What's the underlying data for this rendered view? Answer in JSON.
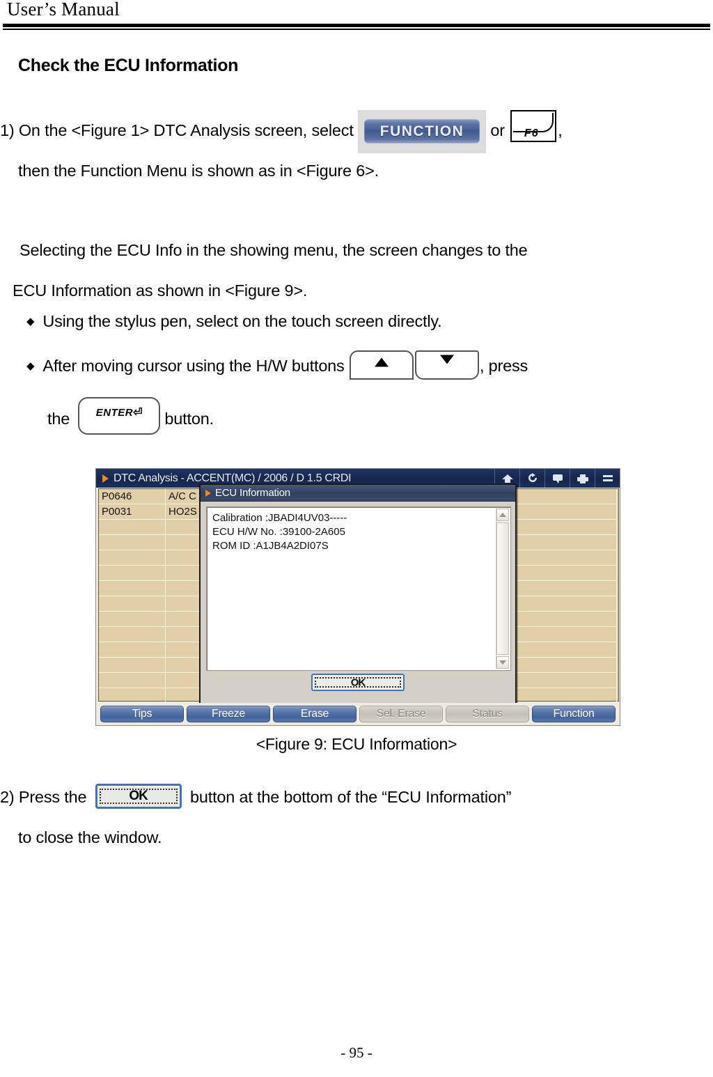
{
  "header": {
    "running_title": "User’s Manual"
  },
  "section": {
    "heading": "Check the ECU Information"
  },
  "steps": {
    "step1": {
      "number": "1)",
      "text_before_function": "On the <Figure 1> DTC Analysis screen, select",
      "or_word": "or",
      "trailing_comma": ",",
      "line2": "then the Function Menu is shown as in <Figure 6>."
    },
    "paragraph": {
      "line1": "Selecting the ECU Info in the showing menu, the screen changes to the",
      "line2": "ECU Information as shown in <Figure 9>."
    },
    "bullets": [
      {
        "marker": "◆",
        "text": "Using the stylus pen, select on the touch screen directly."
      },
      {
        "marker": "◆",
        "text_before_keys": "After  moving  cursor  using  the  H/W  buttons",
        "text_after_keys": ",  press"
      },
      {
        "text_before_enter": "the",
        "text_after_enter": "button."
      }
    ],
    "step2": {
      "number": "2)",
      "text_before_ok": "Press the",
      "text_after_ok": "button at the bottom of the “ECU Information”",
      "line2": "to close the window."
    }
  },
  "inline_buttons": {
    "function_label": "FUNCTION",
    "f6_label": "F6",
    "enter_label": "ENTER",
    "enter_return_glyph": "⏎",
    "ok_label": "OK",
    "up_arrow": "▲",
    "down_arrow": "▼"
  },
  "figure": {
    "caption": "<Figure 9: ECU Information>",
    "device": {
      "titlebar": {
        "title": "DTC Analysis - ACCENT(MC) / 2006 / D 1.5 CRDI",
        "icons": [
          "home-icon",
          "refresh-icon",
          "chat-icon",
          "printer-icon",
          "menu-icon"
        ]
      },
      "table": {
        "columns": 5,
        "rows": 14,
        "visible_rows": [
          {
            "code": "P0646",
            "desc": "A/C C"
          },
          {
            "code": "P0031",
            "desc": "HO2S"
          }
        ],
        "cell_background": "#e3cfa7"
      },
      "softkeys": [
        {
          "label": "Tips",
          "disabled": false
        },
        {
          "label": "Freeze",
          "disabled": false
        },
        {
          "label": "Erase",
          "disabled": false
        },
        {
          "label": "Sel. Erase",
          "disabled": true
        },
        {
          "label": "Status",
          "disabled": true
        },
        {
          "label": "Function",
          "disabled": false
        }
      ],
      "modal": {
        "title": "ECU Information",
        "lines": [
          "Calibration :JBADI4UV03-----",
          "ECU H/W No. :39100-2A605",
          "ROM ID :A1JB4A2DI07S"
        ],
        "ok_label": "OK"
      }
    }
  },
  "footer": {
    "page_number": "- 95 -"
  },
  "colors": {
    "titlebar_navy": "#16264c",
    "modal_titlebar": "#33415f",
    "accent_orange": "#f08a1c",
    "table_cell": "#e3cfa7",
    "softkey_blue": "#41639c",
    "ok_border_blue": "#3f74bd"
  }
}
